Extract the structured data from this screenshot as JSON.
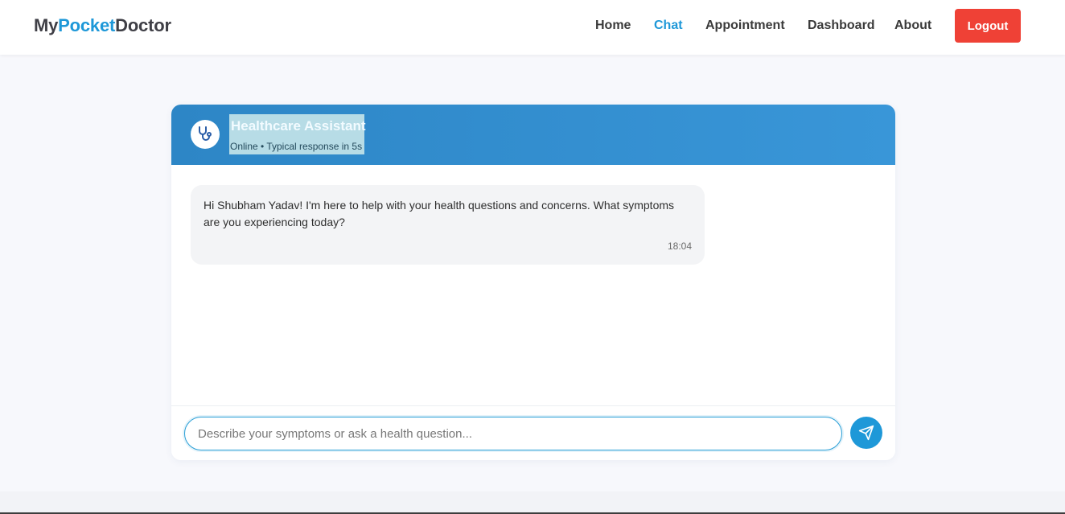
{
  "brand": {
    "part1": "My",
    "part2": "Pocket",
    "part3": "Doctor"
  },
  "nav": {
    "home": "Home",
    "chat": "Chat",
    "appointment": "Appointment",
    "dashboard": "Dashboard",
    "about": "About",
    "logout": "Logout",
    "active": "Chat"
  },
  "chat": {
    "title": "Healthcare Assistant",
    "status": "Online • Typical response in 5s",
    "avatar_icon": "stethoscope-icon",
    "messages": [
      {
        "sender": "assistant",
        "text": "Hi Shubham Yadav! I'm here to help with your health questions and concerns. What symptoms are you experiencing today?",
        "time": "18:04"
      }
    ],
    "input": {
      "placeholder": "Describe your symptoms or ask a health question...",
      "value": ""
    },
    "send_icon": "send-icon"
  },
  "colors": {
    "accent": "#1e98d8",
    "header": "#3996d8",
    "logout": "#ef4136",
    "bubble": "#f3f4f6"
  }
}
